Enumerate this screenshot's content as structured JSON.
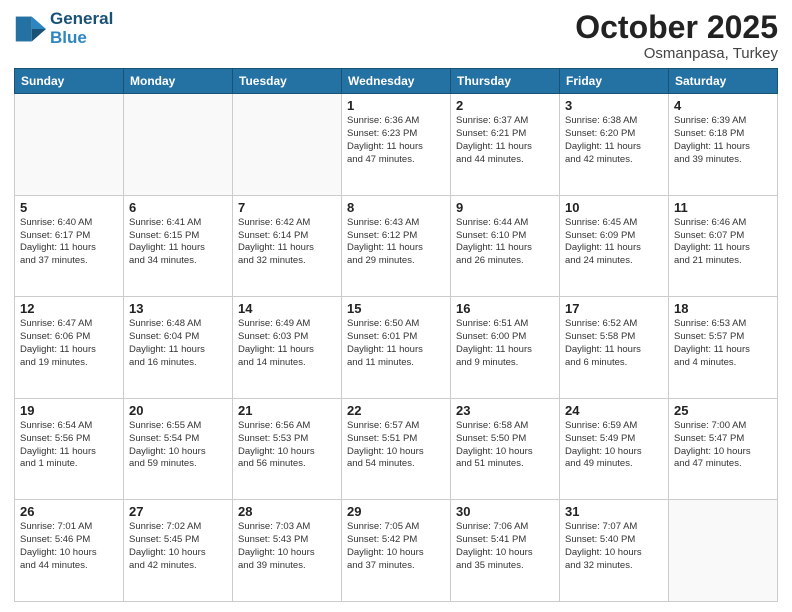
{
  "header": {
    "logo_line1": "General",
    "logo_line2": "Blue",
    "month": "October 2025",
    "location": "Osmanpasa, Turkey"
  },
  "weekdays": [
    "Sunday",
    "Monday",
    "Tuesday",
    "Wednesday",
    "Thursday",
    "Friday",
    "Saturday"
  ],
  "weeks": [
    [
      {
        "day": "",
        "info": ""
      },
      {
        "day": "",
        "info": ""
      },
      {
        "day": "",
        "info": ""
      },
      {
        "day": "1",
        "info": "Sunrise: 6:36 AM\nSunset: 6:23 PM\nDaylight: 11 hours\nand 47 minutes."
      },
      {
        "day": "2",
        "info": "Sunrise: 6:37 AM\nSunset: 6:21 PM\nDaylight: 11 hours\nand 44 minutes."
      },
      {
        "day": "3",
        "info": "Sunrise: 6:38 AM\nSunset: 6:20 PM\nDaylight: 11 hours\nand 42 minutes."
      },
      {
        "day": "4",
        "info": "Sunrise: 6:39 AM\nSunset: 6:18 PM\nDaylight: 11 hours\nand 39 minutes."
      }
    ],
    [
      {
        "day": "5",
        "info": "Sunrise: 6:40 AM\nSunset: 6:17 PM\nDaylight: 11 hours\nand 37 minutes."
      },
      {
        "day": "6",
        "info": "Sunrise: 6:41 AM\nSunset: 6:15 PM\nDaylight: 11 hours\nand 34 minutes."
      },
      {
        "day": "7",
        "info": "Sunrise: 6:42 AM\nSunset: 6:14 PM\nDaylight: 11 hours\nand 32 minutes."
      },
      {
        "day": "8",
        "info": "Sunrise: 6:43 AM\nSunset: 6:12 PM\nDaylight: 11 hours\nand 29 minutes."
      },
      {
        "day": "9",
        "info": "Sunrise: 6:44 AM\nSunset: 6:10 PM\nDaylight: 11 hours\nand 26 minutes."
      },
      {
        "day": "10",
        "info": "Sunrise: 6:45 AM\nSunset: 6:09 PM\nDaylight: 11 hours\nand 24 minutes."
      },
      {
        "day": "11",
        "info": "Sunrise: 6:46 AM\nSunset: 6:07 PM\nDaylight: 11 hours\nand 21 minutes."
      }
    ],
    [
      {
        "day": "12",
        "info": "Sunrise: 6:47 AM\nSunset: 6:06 PM\nDaylight: 11 hours\nand 19 minutes."
      },
      {
        "day": "13",
        "info": "Sunrise: 6:48 AM\nSunset: 6:04 PM\nDaylight: 11 hours\nand 16 minutes."
      },
      {
        "day": "14",
        "info": "Sunrise: 6:49 AM\nSunset: 6:03 PM\nDaylight: 11 hours\nand 14 minutes."
      },
      {
        "day": "15",
        "info": "Sunrise: 6:50 AM\nSunset: 6:01 PM\nDaylight: 11 hours\nand 11 minutes."
      },
      {
        "day": "16",
        "info": "Sunrise: 6:51 AM\nSunset: 6:00 PM\nDaylight: 11 hours\nand 9 minutes."
      },
      {
        "day": "17",
        "info": "Sunrise: 6:52 AM\nSunset: 5:58 PM\nDaylight: 11 hours\nand 6 minutes."
      },
      {
        "day": "18",
        "info": "Sunrise: 6:53 AM\nSunset: 5:57 PM\nDaylight: 11 hours\nand 4 minutes."
      }
    ],
    [
      {
        "day": "19",
        "info": "Sunrise: 6:54 AM\nSunset: 5:56 PM\nDaylight: 11 hours\nand 1 minute."
      },
      {
        "day": "20",
        "info": "Sunrise: 6:55 AM\nSunset: 5:54 PM\nDaylight: 10 hours\nand 59 minutes."
      },
      {
        "day": "21",
        "info": "Sunrise: 6:56 AM\nSunset: 5:53 PM\nDaylight: 10 hours\nand 56 minutes."
      },
      {
        "day": "22",
        "info": "Sunrise: 6:57 AM\nSunset: 5:51 PM\nDaylight: 10 hours\nand 54 minutes."
      },
      {
        "day": "23",
        "info": "Sunrise: 6:58 AM\nSunset: 5:50 PM\nDaylight: 10 hours\nand 51 minutes."
      },
      {
        "day": "24",
        "info": "Sunrise: 6:59 AM\nSunset: 5:49 PM\nDaylight: 10 hours\nand 49 minutes."
      },
      {
        "day": "25",
        "info": "Sunrise: 7:00 AM\nSunset: 5:47 PM\nDaylight: 10 hours\nand 47 minutes."
      }
    ],
    [
      {
        "day": "26",
        "info": "Sunrise: 7:01 AM\nSunset: 5:46 PM\nDaylight: 10 hours\nand 44 minutes."
      },
      {
        "day": "27",
        "info": "Sunrise: 7:02 AM\nSunset: 5:45 PM\nDaylight: 10 hours\nand 42 minutes."
      },
      {
        "day": "28",
        "info": "Sunrise: 7:03 AM\nSunset: 5:43 PM\nDaylight: 10 hours\nand 39 minutes."
      },
      {
        "day": "29",
        "info": "Sunrise: 7:05 AM\nSunset: 5:42 PM\nDaylight: 10 hours\nand 37 minutes."
      },
      {
        "day": "30",
        "info": "Sunrise: 7:06 AM\nSunset: 5:41 PM\nDaylight: 10 hours\nand 35 minutes."
      },
      {
        "day": "31",
        "info": "Sunrise: 7:07 AM\nSunset: 5:40 PM\nDaylight: 10 hours\nand 32 minutes."
      },
      {
        "day": "",
        "info": ""
      }
    ]
  ]
}
